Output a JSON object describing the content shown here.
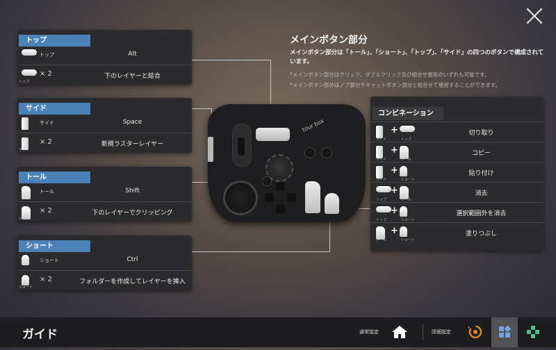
{
  "left_panels": [
    {
      "header": "トップ",
      "rows": [
        {
          "icon": "top-button-icon",
          "sub": "トップ",
          "value": "Alt"
        },
        {
          "icon": "top-button-icon",
          "sub": "× 2",
          "caption": "トップ",
          "value": "下のレイヤーと結合"
        }
      ]
    },
    {
      "header": "サイド",
      "rows": [
        {
          "icon": "side-button-icon",
          "sub": "サイド",
          "value": "Space"
        },
        {
          "icon": "side-button-icon",
          "sub": "× 2",
          "caption": "サイド",
          "value": "新規ラスターレイヤー"
        }
      ]
    },
    {
      "header": "トール",
      "rows": [
        {
          "icon": "toll-button-icon",
          "sub": "トール",
          "value": "Shift"
        },
        {
          "icon": "toll-button-icon",
          "sub": "× 2",
          "caption": "トール",
          "value": "下のレイヤーでクリッピング"
        }
      ]
    },
    {
      "header": "ショート",
      "rows": [
        {
          "icon": "short-button-icon",
          "sub": "ショート",
          "value": "Ctrl"
        },
        {
          "icon": "short-button-icon",
          "sub": "× 2",
          "caption": "ショート",
          "value": "フォルダーを作成してレイヤーを挿入"
        }
      ]
    }
  ],
  "info": {
    "title": "メインボタン部分",
    "description": "メインボタン部分は「トール」、「ショート」、「トップ」、「サイド」の四つのボタンで構成されています。",
    "notes": [
      "*メインボタン部分はクリック、ダブルクリック及び組合せ使用のいずれも可能です。",
      "*メインボタン部分はノブ部分やキャットボタン部分と組合せて使用することができます。"
    ]
  },
  "combination": {
    "header": "コンビネーション",
    "rows": [
      {
        "icon1": "side-button-icon",
        "cap1": "サイド",
        "icon2": "top-button-icon",
        "cap2": "トップ",
        "value": "切り取り"
      },
      {
        "icon1": "side-button-icon",
        "cap1": "サイド",
        "icon2": "toll-button-icon",
        "cap2": "トール",
        "value": "コピー"
      },
      {
        "icon1": "side-button-icon",
        "cap1": "サイド",
        "icon2": "short-button-icon",
        "cap2": "ショート",
        "value": "貼り付け"
      },
      {
        "icon1": "top-button-icon",
        "cap1": "トップ",
        "icon2": "toll-button-icon",
        "cap2": "トール",
        "value": "消去"
      },
      {
        "icon1": "top-button-icon",
        "cap1": "トップ",
        "icon2": "short-button-icon",
        "cap2": "ショート",
        "value": "選択範囲外を消去"
      },
      {
        "icon1": "toll-button-icon",
        "cap1": "トール",
        "icon2": "short-button-icon",
        "cap2": "ショート",
        "value": "塗りつぶし"
      }
    ]
  },
  "device": {
    "logo": "tour box"
  },
  "bottom_bar": {
    "title": "ガイド",
    "normal_settings_label": "通常設定",
    "detail_settings_label": "詳細設定"
  },
  "colors": {
    "accent_blue": "#4a82b8",
    "panel_bg": "#2b2b2d",
    "bottom_bar": "#1d1d1f",
    "active_tab": "#505256",
    "orange_icon": "#e8862a",
    "green_icon": "#4cc38a"
  }
}
